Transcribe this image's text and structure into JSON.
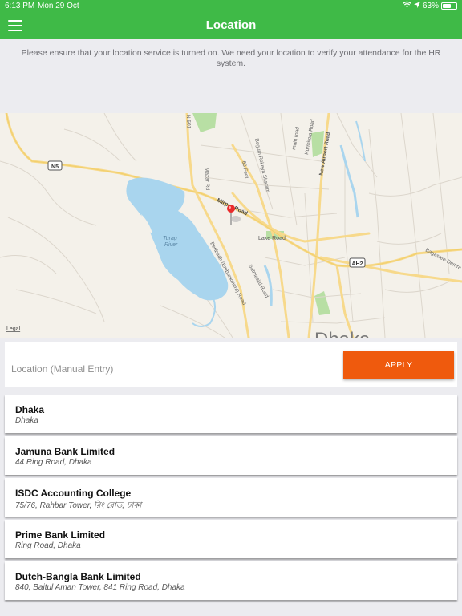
{
  "status_bar": {
    "time": "6:13 PM",
    "date": "Mon 29 Oct",
    "battery": "63%",
    "battery_level": 0.63
  },
  "header": {
    "title": "Location",
    "menu_icon": "hamburger-menu-icon"
  },
  "notice": "Please ensure that your location service is turned on. We need your location to verify your attendance for the HR system.",
  "map": {
    "labels": {
      "n5": "N5",
      "ah2": "AH2",
      "mirpur": "Mirpur Road",
      "lake": "Lake Road",
      "turag": "Turag",
      "river": "River",
      "airport": "New Airport Road",
      "begum": "Begum Rokeya Sharani",
      "satmasjid": "Satmasjid Road",
      "beribadh": "Beribadh (Embankment) Road",
      "bangabandhu": "Bagasree-Demra",
      "mazar": "Mazar Rd",
      "feet60": "60 Feet",
      "kuril": "Kurmitola Road",
      "manik": "main road",
      "n501": "N 501",
      "dhaka": "Dhaka",
      "legal": "Legal"
    },
    "pin_icon": "map-pin-icon",
    "colors": {
      "water": "#a9d5ee",
      "park": "#b8dfa4",
      "road": "#f7d98b",
      "minor_road": "#dcd6cc",
      "land": "#f4f1ea"
    }
  },
  "entry": {
    "placeholder": "Location (Manual Entry)",
    "value": "",
    "apply_label": "APPLY"
  },
  "results": [
    {
      "name": "Dhaka",
      "address": "Dhaka"
    },
    {
      "name": "Jamuna Bank Limited",
      "address": "44 Ring Road, Dhaka"
    },
    {
      "name": "ISDC Accounting College",
      "address": "75/76, Rahbar Tower, রিং রোড, ঢাকা"
    },
    {
      "name": "Prime Bank Limited",
      "address": "Ring Road, Dhaka"
    },
    {
      "name": "Dutch-Bangla Bank Limited",
      "address": "840, Baitul Aman Tower, 841 Ring Road, Dhaka"
    }
  ],
  "colors": {
    "brand_green": "#3fba47",
    "apply_orange": "#ef5a0d",
    "background": "#ececf0"
  }
}
